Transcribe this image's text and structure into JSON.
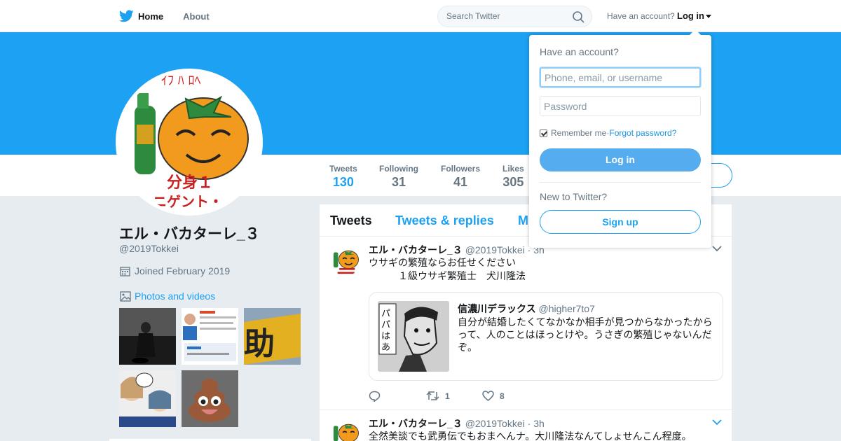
{
  "nav": {
    "home_label": "Home",
    "about_label": "About",
    "search_placeholder": "Search Twitter",
    "account_prompt": "Have an account?",
    "login_label": "Log in"
  },
  "colors": {
    "brand": "#1da1f2",
    "background": "#e6ecf0",
    "button": "#55acee"
  },
  "profile": {
    "name": "エル・バカターレ_３",
    "handle": "@2019Tokkei",
    "joined": "Joined February 2019",
    "photos_label": "Photos and videos",
    "stats": [
      {
        "label": "Tweets",
        "value": "130"
      },
      {
        "label": "Following",
        "value": "31"
      },
      {
        "label": "Followers",
        "value": "41"
      },
      {
        "label": "Likes",
        "value": "305"
      }
    ]
  },
  "timeline": {
    "tabs": [
      "Tweets",
      "Tweets & replies",
      "M"
    ],
    "tweets": [
      {
        "name": "エル・バカターレ_３",
        "handle": "@2019Tokkei",
        "time": "3h",
        "text": "ウサギの繁殖ならお任せください\n　　　１級ウサギ繁殖士　犬川隆法",
        "quote": {
          "name": "信濃川デラックス",
          "handle": "@higher7to7",
          "text": "自分が結婚したくてなかなか相手が見つからなかったからって、人のことはほっとけや。うさぎの繁殖じゃないんだぞ。"
        },
        "retweets": "1",
        "likes": "8"
      },
      {
        "name": "エル・バカターレ_３",
        "handle": "@2019Tokkei",
        "time": "3h",
        "text": "全然美談でも武勇伝でもおまへんナ。大川隆法なんてしょせんこん程度。"
      }
    ]
  },
  "login_dropdown": {
    "title": "Have an account?",
    "username_placeholder": "Phone, email, or username",
    "password_placeholder": "Password",
    "remember_label": "Remember me",
    "separator": " · ",
    "forgot_label": "Forgot password?",
    "login_button": "Log in",
    "new_prompt": "New to Twitter?",
    "signup_button": "Sign up"
  }
}
